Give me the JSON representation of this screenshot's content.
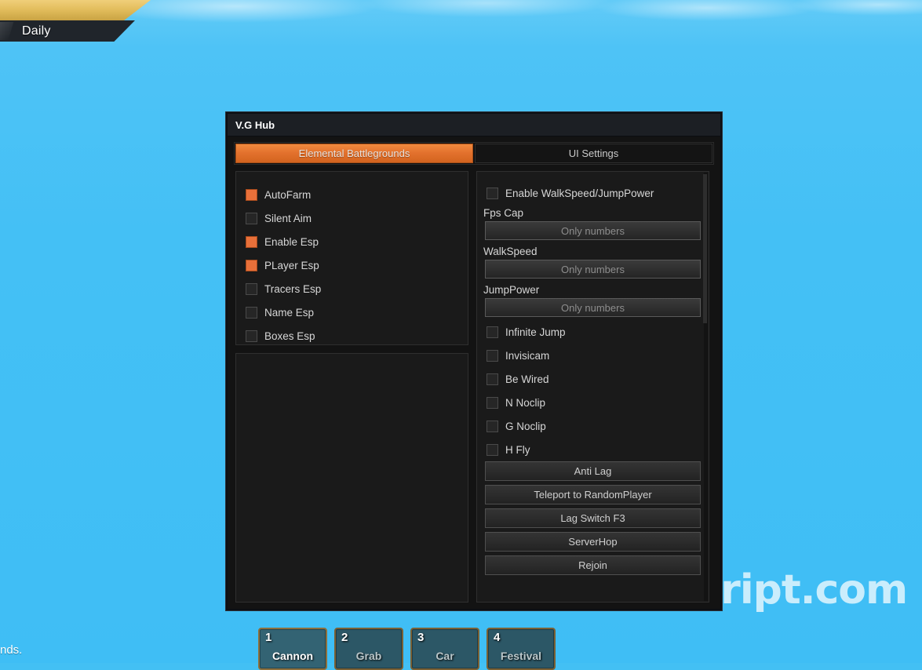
{
  "game": {
    "daily_tab_label": "Daily",
    "chat_remnant": "nds.",
    "watermark": "rbxscript.com",
    "hotbar": [
      {
        "num": "1",
        "name": "Cannon",
        "active": true
      },
      {
        "num": "2",
        "name": "Grab",
        "active": false
      },
      {
        "num": "3",
        "name": "Car",
        "active": false
      },
      {
        "num": "4",
        "name": "Festival",
        "active": false
      }
    ]
  },
  "window": {
    "title": "V.G Hub",
    "tabs": [
      {
        "label": "Elemental Battlegrounds",
        "active": true
      },
      {
        "label": "UI Settings",
        "active": false
      }
    ]
  },
  "left_panel": {
    "toggles": [
      {
        "label": "AutoFarm",
        "checked": true
      },
      {
        "label": "Silent Aim",
        "checked": false
      },
      {
        "label": "Enable Esp",
        "checked": true
      },
      {
        "label": "PLayer Esp",
        "checked": true
      },
      {
        "label": "Tracers Esp",
        "checked": false
      },
      {
        "label": "Name Esp",
        "checked": false
      },
      {
        "label": "Boxes Esp",
        "checked": false
      }
    ]
  },
  "right_panel": {
    "enable_toggle": {
      "label": "Enable WalkSpeed/JumpPower",
      "checked": false
    },
    "fields": [
      {
        "label": "Fps Cap",
        "value": "",
        "placeholder": "Only numbers"
      },
      {
        "label": "WalkSpeed",
        "value": "",
        "placeholder": "Only numbers"
      },
      {
        "label": "JumpPower",
        "value": "",
        "placeholder": "Only numbers"
      }
    ],
    "toggles": [
      {
        "label": "Infinite Jump",
        "checked": false
      },
      {
        "label": "Invisicam",
        "checked": false
      },
      {
        "label": "Be Wired",
        "checked": false
      },
      {
        "label": "N Noclip",
        "checked": false
      },
      {
        "label": "G Noclip",
        "checked": false
      },
      {
        "label": "H Fly",
        "checked": false
      }
    ],
    "buttons": [
      {
        "label": "Anti Lag"
      },
      {
        "label": "Teleport to RandomPlayer"
      },
      {
        "label": "Lag Switch F3"
      },
      {
        "label": "ServerHop"
      },
      {
        "label": "Rejoin"
      }
    ]
  },
  "colors": {
    "accent_orange": "#e8703a",
    "sky_blue": "#43c0f4",
    "panel_dark": "#1a1a1a",
    "gold": "#e3be5d"
  }
}
